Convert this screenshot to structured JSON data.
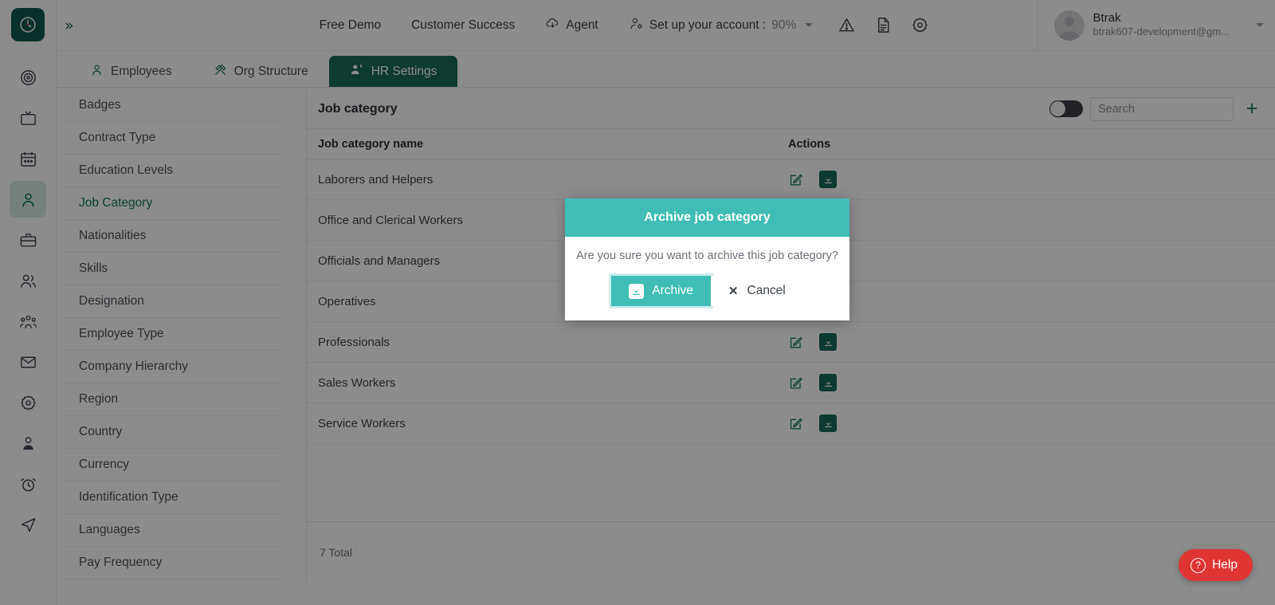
{
  "app": {
    "logo_icon": "clock-logo-icon",
    "expand_icon": "chevrons-right-icon"
  },
  "rail": {
    "items": [
      {
        "icon": "target-icon",
        "name": "dashboard",
        "active": false
      },
      {
        "icon": "tv-icon",
        "name": "screens",
        "active": false
      },
      {
        "icon": "calendar-icon",
        "name": "calendar",
        "active": false
      },
      {
        "icon": "person-icon",
        "name": "employees",
        "active": true
      },
      {
        "icon": "briefcase-icon",
        "name": "jobs",
        "active": false
      },
      {
        "icon": "users-icon",
        "name": "teams",
        "active": false
      },
      {
        "icon": "group-icon",
        "name": "groups",
        "active": false
      },
      {
        "icon": "mail-icon",
        "name": "mail",
        "active": false
      },
      {
        "icon": "gear-icon",
        "name": "settings",
        "active": false
      },
      {
        "icon": "user-badge-icon",
        "name": "profile",
        "active": false
      },
      {
        "icon": "alarm-clock-icon",
        "name": "timesheet",
        "active": false
      },
      {
        "icon": "send-icon",
        "name": "send",
        "active": false
      }
    ]
  },
  "topbar": {
    "nav": [
      {
        "label": "Free Demo",
        "icon": ""
      },
      {
        "label": "Customer Success",
        "icon": ""
      },
      {
        "label": "Agent",
        "icon": "cloud-download-icon"
      }
    ],
    "account_setup": {
      "label": "Set up your account : ",
      "percent": "90%",
      "icon": "user-settings-icon"
    },
    "icons": [
      {
        "name": "warning-icon"
      },
      {
        "name": "document-icon"
      },
      {
        "name": "gear-icon"
      }
    ],
    "profile": {
      "name": "Btrak",
      "email": "btrak607-development@gm...",
      "avatar_icon": "avatar-icon"
    }
  },
  "tabs": [
    {
      "label": "Employees",
      "icon": "person-icon",
      "active": false
    },
    {
      "label": "Org Structure",
      "icon": "tools-icon",
      "active": false
    },
    {
      "label": "HR Settings",
      "icon": "user-gear-icon",
      "active": true
    }
  ],
  "settings_list": {
    "items": [
      {
        "label": "Badges",
        "active": false
      },
      {
        "label": "Contract Type",
        "active": false
      },
      {
        "label": "Education Levels",
        "active": false
      },
      {
        "label": "Job Category",
        "active": true
      },
      {
        "label": "Nationalities",
        "active": false
      },
      {
        "label": "Skills",
        "active": false
      },
      {
        "label": "Designation",
        "active": false
      },
      {
        "label": "Employee Type",
        "active": false
      },
      {
        "label": "Company Hierarchy",
        "active": false
      },
      {
        "label": "Region",
        "active": false
      },
      {
        "label": "Country",
        "active": false
      },
      {
        "label": "Currency",
        "active": false
      },
      {
        "label": "Identification Type",
        "active": false
      },
      {
        "label": "Languages",
        "active": false
      },
      {
        "label": "Pay Frequency",
        "active": false
      }
    ]
  },
  "panel": {
    "title": "Job category",
    "search_placeholder": "Search",
    "search_value": "",
    "add_icon": "plus-icon",
    "archive_toggle_on": false,
    "columns": [
      "Job category name",
      "Actions"
    ],
    "rows": [
      {
        "name": "Laborers and Helpers"
      },
      {
        "name": "Office and Clerical Workers"
      },
      {
        "name": "Officials and Managers"
      },
      {
        "name": "Operatives"
      },
      {
        "name": "Professionals"
      },
      {
        "name": "Sales Workers"
      },
      {
        "name": "Service Workers"
      }
    ],
    "footer_total": "7 Total",
    "row_edit_icon": "edit-pencil-icon",
    "row_archive_icon": "archive-box-icon"
  },
  "modal": {
    "title": "Archive job category",
    "message": "Are you sure you want to archive this job category?",
    "confirm_label": "Archive",
    "confirm_icon": "archive-box-icon",
    "cancel_label": "Cancel",
    "cancel_icon": "close-x-icon"
  },
  "help": {
    "label": "Help",
    "icon": "question-circle-icon"
  },
  "colors": {
    "brand_dark_green": "#186b5a",
    "accent_green": "#17795f",
    "modal_teal": "#3fbdb6",
    "help_red": "#e03535"
  }
}
